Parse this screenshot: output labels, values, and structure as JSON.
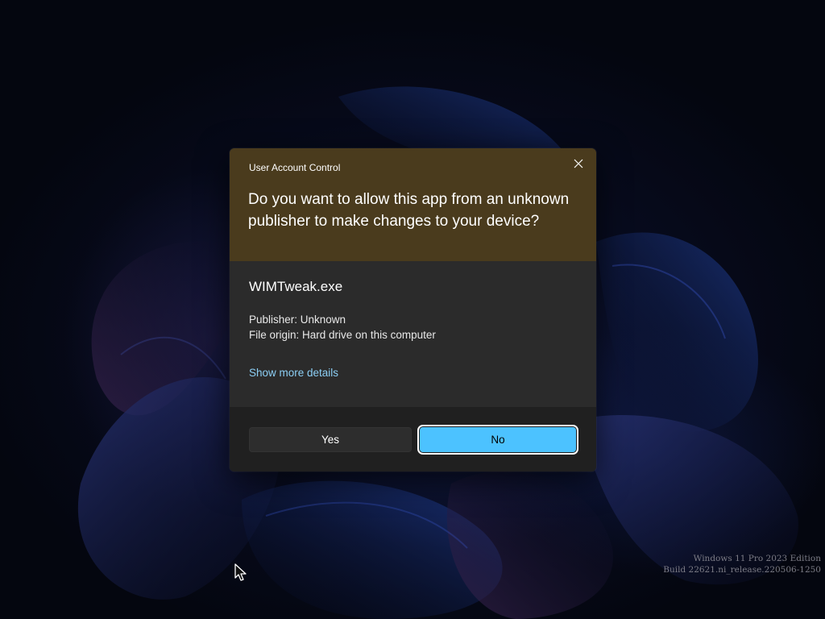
{
  "dialog": {
    "title": "User Account Control",
    "question": "Do you want to allow this app from an unknown publisher to make changes to your device?",
    "app_name": "WIMTweak.exe",
    "publisher": "Publisher: Unknown",
    "file_origin": "File origin: Hard drive on this computer",
    "details_link": "Show more details",
    "yes_label": "Yes",
    "no_label": "No",
    "close_icon": "close-icon",
    "header_color": "#4a3b1d",
    "accent_color": "#4cc2ff"
  },
  "watermark": {
    "line1": "Windows 11 Pro 2023 Edition",
    "line2": "Build 22621.ni_release.220506-1250"
  },
  "cursor_icon": "mouse-pointer-icon"
}
